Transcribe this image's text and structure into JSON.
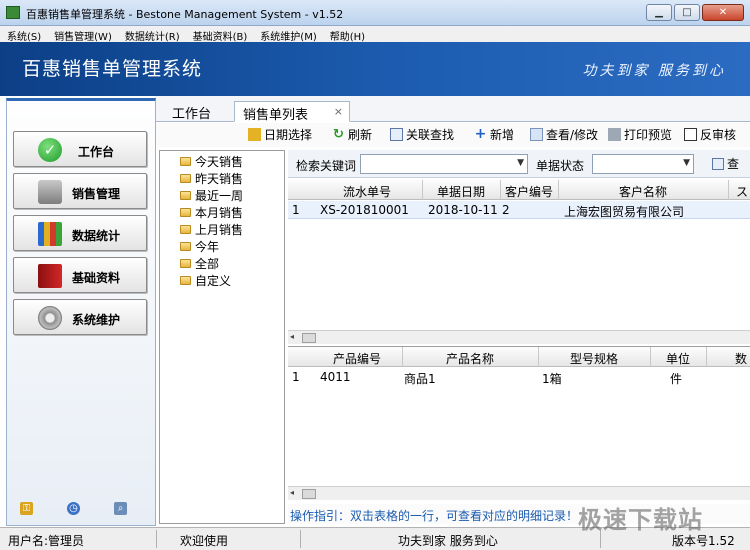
{
  "window": {
    "title": "百惠销售单管理系统 - Bestone Management System - v1.52",
    "buttons": {
      "minimize": "▁",
      "maximize": "□",
      "close": "✕"
    }
  },
  "menu": [
    "系统(S)",
    "销售管理(W)",
    "数据统计(R)",
    "基础资料(B)",
    "系统维护(M)",
    "帮助(H)"
  ],
  "banner": {
    "app_name": "百惠销售单管理系统",
    "slogan": "功夫到家 服务到心"
  },
  "nav": {
    "items": [
      {
        "label": "工作台",
        "icon": "check-icon"
      },
      {
        "label": "销售管理",
        "icon": "printer-icon"
      },
      {
        "label": "数据统计",
        "icon": "chart-icon"
      },
      {
        "label": "基础资料",
        "icon": "book-icon"
      },
      {
        "label": "系统维护",
        "icon": "gear-icon"
      }
    ],
    "footer_icons": [
      "key-icon",
      "clock-icon",
      "search-icon"
    ]
  },
  "tabs": [
    {
      "label": "工作台"
    },
    {
      "label": "销售单列表",
      "close": "×"
    }
  ],
  "toolbar": {
    "date_select": "日期选择",
    "refresh": "刷新",
    "related_search": "关联查找",
    "add": "新增",
    "view_edit": "查看/修改",
    "print_preview": "打印预览",
    "unaudit": "反审核"
  },
  "tree": [
    "今天销售",
    "昨天销售",
    "最近一周",
    "本月销售",
    "上月销售",
    "今年",
    "全部",
    "自定义"
  ],
  "search": {
    "keyword_label": "检索关键词",
    "keyword_value": "",
    "status_label": "单据状态",
    "status_value": "",
    "query": "查"
  },
  "orders": {
    "columns": [
      "流水单号",
      "单据日期",
      "客户编号",
      "客户名称",
      "ス"
    ],
    "rows": [
      {
        "index": "1",
        "order_no": "XS-201810001",
        "date": "2018-10-11",
        "customer_no": "2",
        "customer_name": "上海宏图贸易有限公司"
      }
    ]
  },
  "details": {
    "columns": [
      "产品编号",
      "产品名称",
      "型号规格",
      "单位",
      "数"
    ],
    "rows": [
      {
        "index": "1",
        "product_no": "4011",
        "product_name": "商品1",
        "spec": "1箱",
        "unit": "件"
      }
    ]
  },
  "guide": "操作指引：双击表格的一行，可查看对应的明细记录！",
  "statusbar": {
    "user": "用户名:管理员",
    "welcome": "欢迎使用",
    "motto": "功夫到家 服务到心",
    "version": "版本号1.52"
  },
  "watermark": "极速下载站",
  "colors": {
    "banner": "#1d5db1",
    "guide_text": "#1a5bb0",
    "selected_row": "#e8f1fc"
  }
}
